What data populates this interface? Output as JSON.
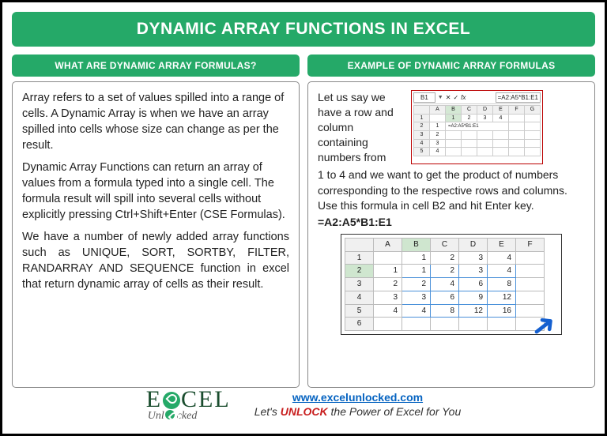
{
  "title": "DYNAMIC ARRAY FUNCTIONS IN EXCEL",
  "left": {
    "heading": "WHAT ARE DYNAMIC ARRAY FORMULAS?",
    "p1": "Array refers to a set of values spilled into a range of cells. A Dynamic Array is when we have an array spilled into cells whose size can change as per the result.",
    "p2": "Dynamic Array Functions can return an array of values from a formula typed into a single cell. The formula result will spill into several cells without explicitly pressing Ctrl+Shift+Enter (CSE Formulas).",
    "p3": "We have a number of newly added array functions such as UNIQUE, SORT, SORTBY, FILTER, RANDARRAY AND SEQUENCE function in excel that return dynamic array of cells as their result."
  },
  "right": {
    "heading": "EXAMPLE OF DYNAMIC ARRAY FORMULAS",
    "intro1": "Let us say we have a row and column containing numbers from",
    "intro2": "1 to 4 and we want to get the product of numbers corresponding to the respective rows and columns. Use this formula in cell B2 and hit Enter key.",
    "formula": "=A2:A5*B1:E1",
    "ex1": {
      "cellref": "B1",
      "fx": "fx",
      "formulabar": "=A2:A5*B1:E1",
      "cols": [
        "A",
        "B",
        "C",
        "D",
        "E",
        "F",
        "G"
      ],
      "rows": [
        "1",
        "2",
        "3",
        "4",
        "5"
      ],
      "row1": [
        "",
        "1",
        "2",
        "3",
        "4",
        "",
        ""
      ],
      "b2": "=A2:A5*B1:E1",
      "acol": [
        "1",
        "2",
        "3",
        "4"
      ]
    },
    "ex2": {
      "cols": [
        "A",
        "B",
        "C",
        "D",
        "E",
        "F"
      ],
      "rows": [
        "1",
        "2",
        "3",
        "4",
        "5",
        "6"
      ],
      "hdr": [
        "",
        "1",
        "2",
        "3",
        "4",
        ""
      ],
      "data": [
        [
          "1",
          "1",
          "2",
          "3",
          "4",
          ""
        ],
        [
          "2",
          "2",
          "4",
          "6",
          "8",
          ""
        ],
        [
          "3",
          "3",
          "6",
          "9",
          "12",
          ""
        ],
        [
          "4",
          "4",
          "8",
          "12",
          "16",
          ""
        ]
      ]
    }
  },
  "footer": {
    "brand1": "E",
    "brand2": "CEL",
    "sub": "Unl",
    "sub2": "cked",
    "url": "www.excelunlocked.com",
    "tag1": "Let's ",
    "unlock": "UNLOCK",
    "tag2": " the Power of Excel for You"
  }
}
